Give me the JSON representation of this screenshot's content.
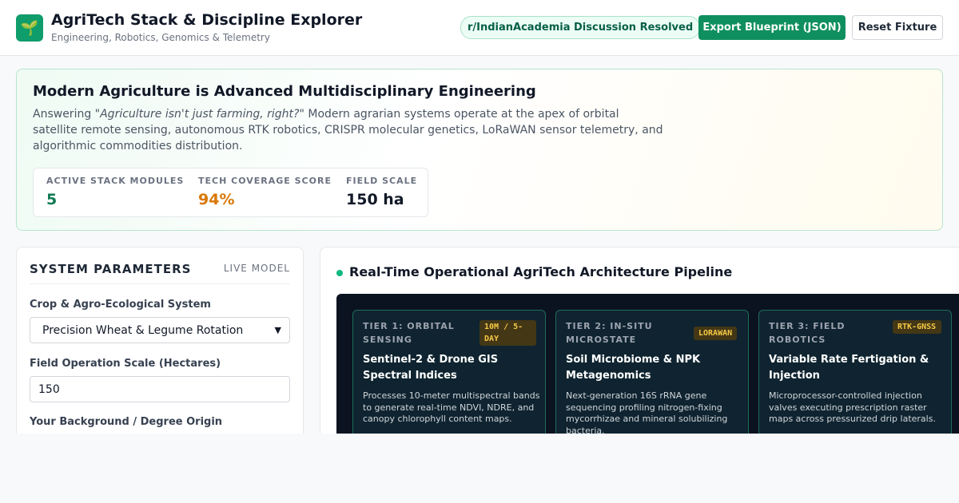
{
  "header": {
    "logo_glyph": "🌱",
    "title": "AgriTech Stack & Discipline Explorer",
    "subtitle": "Engineering, Robotics, Genomics & Telemetry",
    "discussion_badge": "r/IndianAcademia Discussion Resolved",
    "export_label": "Export Blueprint (JSON)",
    "reset_label": "Reset Fixture"
  },
  "hero": {
    "title": "Modern Agriculture is Advanced Multidisciplinary Engineering",
    "desc_prefix": "Answering \"",
    "desc_quote": "Agriculture isn't just farming, right?",
    "desc_rest": "\" Modern agrarian systems operate at the apex of orbital satellite remote sensing, autonomous RTK robotics, CRISPR molecular genetics, LoRaWAN sensor telemetry, and algorithmic commodities distribution.",
    "stats": [
      {
        "label": "ACTIVE STACK MODULES",
        "value": "5",
        "color": "#0f7a52"
      },
      {
        "label": "TECH COVERAGE SCORE",
        "value": "94%",
        "color": "#d97706"
      },
      {
        "label": "FIELD SCALE",
        "value": "150 ha",
        "color": "#111827"
      }
    ]
  },
  "params": {
    "title": "SYSTEM PARAMETERS",
    "tag": "LIVE MODEL",
    "crop_label": "Crop & Agro-Ecological System",
    "crop_value": "Precision Wheat & Legume Rotation",
    "scale_label": "Field Operation Scale (Hectares)",
    "scale_value": "150",
    "background_label": "Your Background / Degree Origin"
  },
  "pipeline": {
    "title": "Real-Time Operational AgriTech Architecture Pipeline",
    "tiers": [
      {
        "label": "TIER 1: ORBITAL SENSING",
        "badge": "10M / 5-DAY",
        "title": "Sentinel-2 & Drone GIS Spectral Indices",
        "desc": "Processes 10-meter multispectral bands to generate real-time NDVI, NDRE, and canopy chlorophyll content maps."
      },
      {
        "label": "TIER 2: IN-SITU MICROSTATE",
        "badge": "LORAWAN",
        "title": "Soil Microbiome & NPK Metagenomics",
        "desc": "Next-generation 16S rRNA gene sequencing profiling nitrogen-fixing mycorrhizae and mineral solubilizing bacteria."
      },
      {
        "label": "TIER 3: FIELD ROBOTICS",
        "badge": "RTK-GNSS",
        "title": "Variable Rate Fertigation & Injection",
        "desc": "Microprocessor-controlled injection valves executing prescription raster maps across pressurized drip laterals."
      }
    ]
  },
  "colors": {
    "brand": "#0f8f5f",
    "badge_text": "#f6c945",
    "dark_panel": "#0b1320"
  }
}
